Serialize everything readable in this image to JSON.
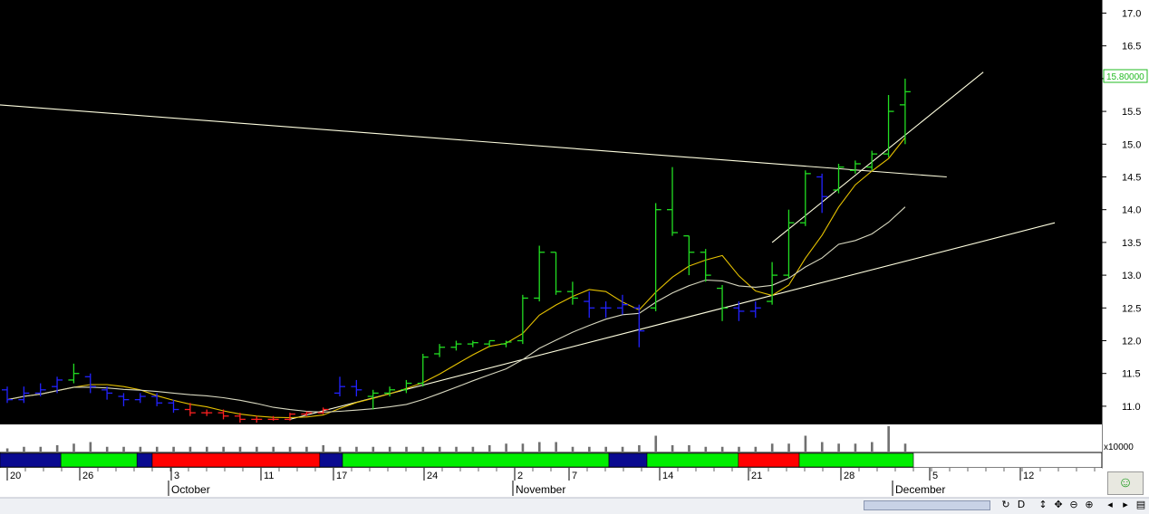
{
  "chart_data": {
    "type": "ohlc",
    "title": "",
    "xlabel": "",
    "ylabel": "",
    "ylim": [
      10.75,
      17.2
    ],
    "y_ticks": [
      11.0,
      11.5,
      12.0,
      12.5,
      13.0,
      13.5,
      14.0,
      14.5,
      15.0,
      15.5,
      16.0,
      16.5,
      17.0
    ],
    "last_price_label": "15.80000",
    "volume_multiplier_label": "x10000",
    "day_ticks": [
      "20",
      "26",
      "3",
      "11",
      "17",
      "24",
      "2",
      "7",
      "14",
      "21",
      "28",
      "5",
      "12"
    ],
    "month_labels": [
      "October",
      "November",
      "December"
    ],
    "bars": [
      {
        "o": 11.25,
        "h": 11.3,
        "l": 11.05,
        "c": 11.1,
        "color": "blue"
      },
      {
        "o": 11.1,
        "h": 11.3,
        "l": 11.05,
        "c": 11.2,
        "color": "blue"
      },
      {
        "o": 11.2,
        "h": 11.35,
        "l": 11.15,
        "c": 11.25,
        "color": "blue"
      },
      {
        "o": 11.3,
        "h": 11.45,
        "l": 11.2,
        "c": 11.4,
        "color": "blue"
      },
      {
        "o": 11.4,
        "h": 11.65,
        "l": 11.35,
        "c": 11.5,
        "color": "green"
      },
      {
        "o": 11.45,
        "h": 11.5,
        "l": 11.2,
        "c": 11.3,
        "color": "blue"
      },
      {
        "o": 11.25,
        "h": 11.3,
        "l": 11.1,
        "c": 11.2,
        "color": "blue"
      },
      {
        "o": 11.15,
        "h": 11.2,
        "l": 11.0,
        "c": 11.1,
        "color": "blue"
      },
      {
        "o": 11.1,
        "h": 11.2,
        "l": 11.05,
        "c": 11.15,
        "color": "blue"
      },
      {
        "o": 11.15,
        "h": 11.2,
        "l": 11.0,
        "c": 11.05,
        "color": "blue"
      },
      {
        "o": 11.05,
        "h": 11.1,
        "l": 10.9,
        "c": 10.95,
        "color": "blue"
      },
      {
        "o": 10.95,
        "h": 11.05,
        "l": 10.85,
        "c": 10.9,
        "color": "red"
      },
      {
        "o": 10.9,
        "h": 10.95,
        "l": 10.85,
        "c": 10.9,
        "color": "red"
      },
      {
        "o": 10.9,
        "h": 10.95,
        "l": 10.8,
        "c": 10.85,
        "color": "red"
      },
      {
        "o": 10.85,
        "h": 10.9,
        "l": 10.75,
        "c": 10.8,
        "color": "red"
      },
      {
        "o": 10.8,
        "h": 10.85,
        "l": 10.75,
        "c": 10.8,
        "color": "red"
      },
      {
        "o": 10.8,
        "h": 10.85,
        "l": 10.78,
        "c": 10.8,
        "color": "red"
      },
      {
        "o": 10.8,
        "h": 10.9,
        "l": 10.78,
        "c": 10.88,
        "color": "red"
      },
      {
        "o": 10.88,
        "h": 10.92,
        "l": 10.85,
        "c": 10.9,
        "color": "red"
      },
      {
        "o": 10.9,
        "h": 10.98,
        "l": 10.88,
        "c": 10.95,
        "color": "red"
      },
      {
        "o": 11.2,
        "h": 11.45,
        "l": 11.15,
        "c": 11.3,
        "color": "blue"
      },
      {
        "o": 11.3,
        "h": 11.4,
        "l": 11.15,
        "c": 11.25,
        "color": "blue"
      },
      {
        "o": 11.15,
        "h": 11.25,
        "l": 10.95,
        "c": 11.2,
        "color": "green"
      },
      {
        "o": 11.2,
        "h": 11.3,
        "l": 11.15,
        "c": 11.25,
        "color": "green"
      },
      {
        "o": 11.25,
        "h": 11.4,
        "l": 11.2,
        "c": 11.35,
        "color": "green"
      },
      {
        "o": 11.35,
        "h": 11.8,
        "l": 11.3,
        "c": 11.75,
        "color": "green"
      },
      {
        "o": 11.8,
        "h": 11.95,
        "l": 11.75,
        "c": 11.9,
        "color": "green"
      },
      {
        "o": 11.9,
        "h": 12.0,
        "l": 11.85,
        "c": 11.95,
        "color": "green"
      },
      {
        "o": 11.95,
        "h": 12.0,
        "l": 11.9,
        "c": 11.97,
        "color": "green"
      },
      {
        "o": 11.95,
        "h": 12.0,
        "l": 11.9,
        "c": 12.0,
        "color": "green"
      },
      {
        "o": 11.95,
        "h": 12.0,
        "l": 11.9,
        "c": 11.98,
        "color": "green"
      },
      {
        "o": 12.0,
        "h": 12.7,
        "l": 11.95,
        "c": 12.65,
        "color": "green"
      },
      {
        "o": 12.65,
        "h": 13.45,
        "l": 12.6,
        "c": 13.35,
        "color": "green"
      },
      {
        "o": 13.35,
        "h": 13.35,
        "l": 12.7,
        "c": 12.75,
        "color": "green"
      },
      {
        "o": 12.75,
        "h": 12.9,
        "l": 12.55,
        "c": 12.65,
        "color": "green"
      },
      {
        "o": 12.6,
        "h": 12.75,
        "l": 12.35,
        "c": 12.5,
        "color": "blue"
      },
      {
        "o": 12.5,
        "h": 12.6,
        "l": 12.35,
        "c": 12.5,
        "color": "blue"
      },
      {
        "o": 12.5,
        "h": 12.7,
        "l": 12.4,
        "c": 12.55,
        "color": "blue"
      },
      {
        "o": 12.5,
        "h": 12.55,
        "l": 11.9,
        "c": 12.15,
        "color": "blue"
      },
      {
        "o": 12.5,
        "h": 14.1,
        "l": 12.45,
        "c": 14.0,
        "color": "green"
      },
      {
        "o": 14.0,
        "h": 14.65,
        "l": 13.6,
        "c": 13.65,
        "color": "green"
      },
      {
        "o": 13.6,
        "h": 13.6,
        "l": 13.0,
        "c": 13.35,
        "color": "green"
      },
      {
        "o": 13.35,
        "h": 13.4,
        "l": 12.9,
        "c": 13.0,
        "color": "green"
      },
      {
        "o": 12.8,
        "h": 12.85,
        "l": 12.3,
        "c": 12.5,
        "color": "green"
      },
      {
        "o": 12.5,
        "h": 12.6,
        "l": 12.3,
        "c": 12.45,
        "color": "blue"
      },
      {
        "o": 12.45,
        "h": 12.6,
        "l": 12.35,
        "c": 12.5,
        "color": "blue"
      },
      {
        "o": 12.6,
        "h": 13.2,
        "l": 12.55,
        "c": 13.0,
        "color": "green"
      },
      {
        "o": 13.0,
        "h": 14.0,
        "l": 12.95,
        "c": 13.8,
        "color": "green"
      },
      {
        "o": 13.8,
        "h": 14.6,
        "l": 13.75,
        "c": 14.55,
        "color": "green"
      },
      {
        "o": 14.5,
        "h": 14.55,
        "l": 13.95,
        "c": 14.2,
        "color": "blue"
      },
      {
        "o": 14.3,
        "h": 14.7,
        "l": 14.25,
        "c": 14.65,
        "color": "green"
      },
      {
        "o": 14.6,
        "h": 14.75,
        "l": 14.55,
        "c": 14.7,
        "color": "green"
      },
      {
        "o": 14.65,
        "h": 14.9,
        "l": 14.6,
        "c": 14.85,
        "color": "green"
      },
      {
        "o": 14.85,
        "h": 15.75,
        "l": 14.8,
        "c": 15.5,
        "color": "green"
      },
      {
        "o": 15.6,
        "h": 16.0,
        "l": 15.0,
        "c": 15.8,
        "color": "green"
      }
    ],
    "volume": [
      2,
      3,
      3,
      4,
      5,
      6,
      3,
      3,
      3,
      3,
      3,
      3,
      3,
      3,
      3,
      3,
      3,
      3,
      3,
      4,
      3,
      3,
      3,
      3,
      3,
      3,
      3,
      3,
      3,
      4,
      5,
      5,
      6,
      6,
      3,
      3,
      3,
      3,
      4,
      10,
      4,
      4,
      3,
      3,
      3,
      3,
      5,
      5,
      10,
      6,
      5,
      5,
      6,
      16,
      5
    ],
    "regime_segments": [
      {
        "start": 0,
        "end": 7,
        "color": "blue"
      },
      {
        "start": 8,
        "end": 17,
        "color": "green"
      },
      {
        "start": 18,
        "end": 19,
        "color": "blue"
      },
      {
        "start": 20,
        "end": 41,
        "color": "red"
      },
      {
        "start": 42,
        "end": 44,
        "color": "blue"
      },
      {
        "start": 45,
        "end": 79,
        "color": "green"
      },
      {
        "start": 80,
        "end": 84,
        "color": "blue"
      },
      {
        "start": 85,
        "end": 96,
        "color": "green"
      },
      {
        "start": 97,
        "end": 104,
        "color": "red"
      },
      {
        "start": 105,
        "end": 119,
        "color": "green"
      }
    ],
    "colors": {
      "background": "#000000",
      "up": "#22dd22",
      "down": "#2222ff",
      "neutral": "#ff2020",
      "ma_fast": "#e6c200",
      "ma_slow": "#d8d8c0",
      "trendline": "#ffffe0",
      "volume_bar": "#707070",
      "last_price": "#22bb22"
    }
  }
}
